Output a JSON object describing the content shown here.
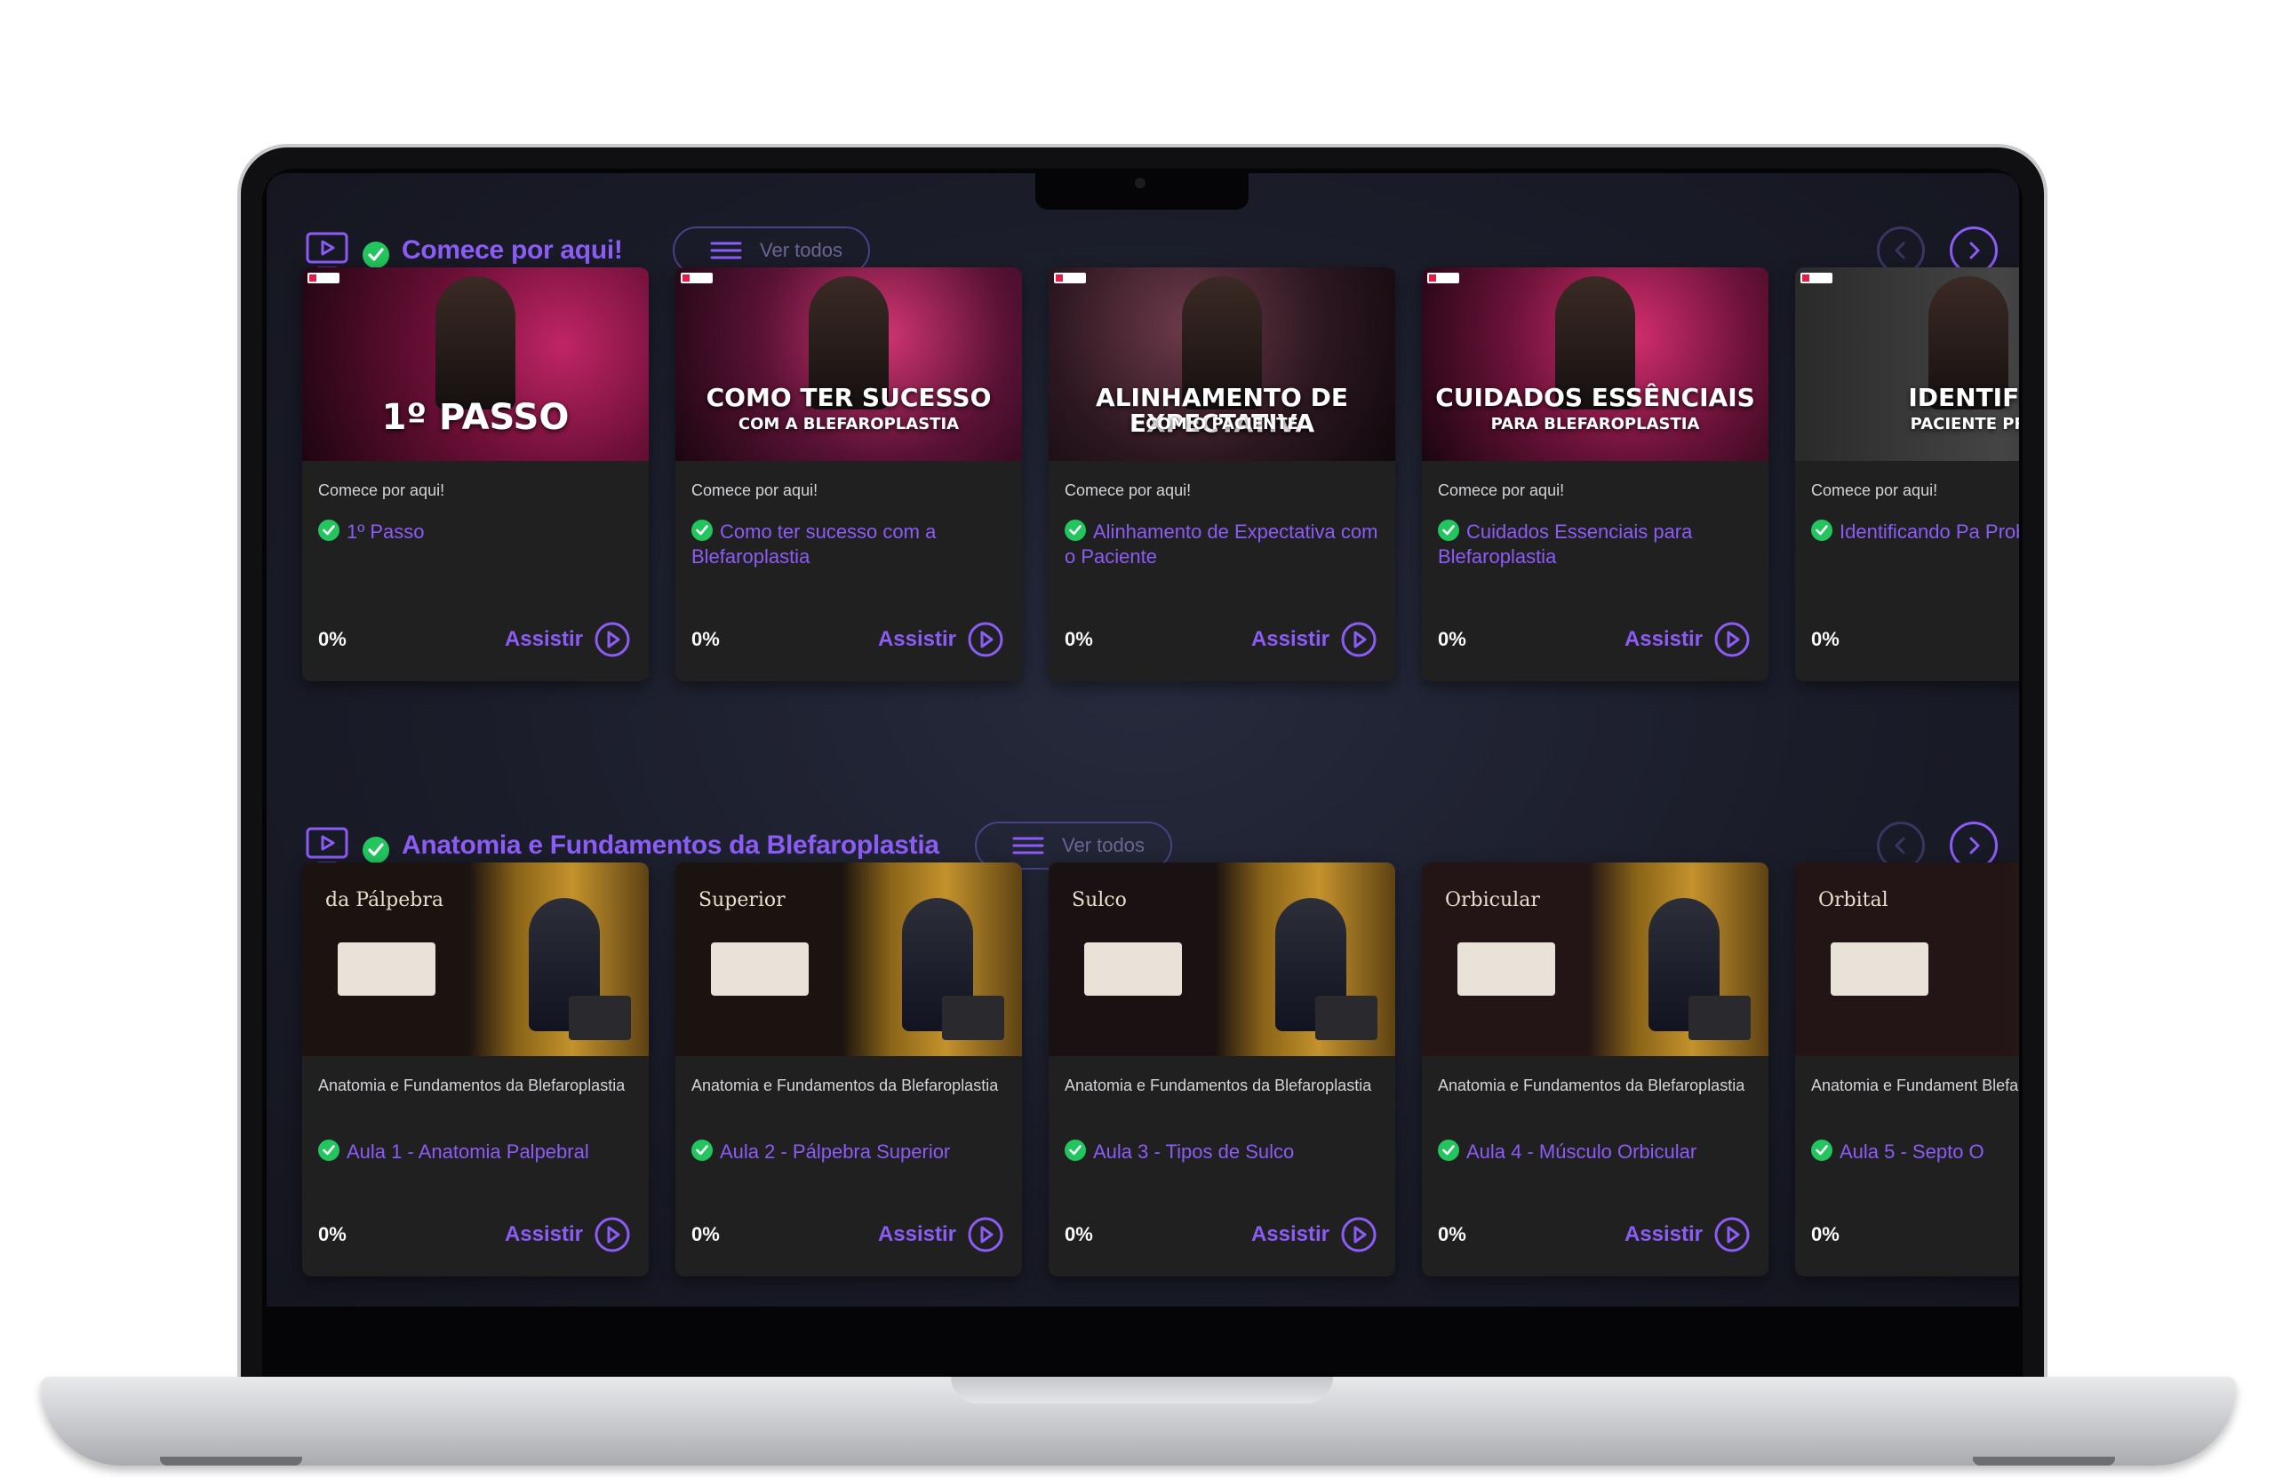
{
  "sections": [
    {
      "title": "Comece por aqui!",
      "ver_todos": "Ver todos",
      "cards": [
        {
          "thumb_line1": "1º PASSO",
          "thumb_line2": "",
          "module": "Comece por aqui!",
          "title": "1º Passo",
          "progress": "0%",
          "action": "Assistir"
        },
        {
          "thumb_line1": "COMO TER SUCESSO",
          "thumb_line2": "COM A BLEFAROPLASTIA",
          "module": "Comece por aqui!",
          "title": "Como ter sucesso com a Blefaroplastia",
          "progress": "0%",
          "action": "Assistir"
        },
        {
          "thumb_line1": "ALINHAMENTO DE EXPECTATIVA",
          "thumb_line2": "COM O PACIENTE",
          "module": "Comece por aqui!",
          "title": "Alinhamento de Expectativa com o Paciente",
          "progress": "0%",
          "action": "Assistir"
        },
        {
          "thumb_line1": "CUIDADOS ESSÊNCIAIS",
          "thumb_line2": "PARA BLEFAROPLASTIA",
          "module": "Comece por aqui!",
          "title": "Cuidados Essenciais para Blefaroplastia",
          "progress": "0%",
          "action": "Assistir"
        },
        {
          "thumb_line1": "IDENTIFI",
          "thumb_line2": "PACIENTE PR",
          "module": "Comece por aqui!",
          "title": "Identificando Pa Problema",
          "progress": "0%",
          "action": ""
        }
      ]
    },
    {
      "title": "Anatomia e Fundamentos da Blefaroplastia",
      "ver_todos": "Ver todos",
      "cards": [
        {
          "thumb_line1": "da Pálpebra",
          "thumb_line2": "",
          "module": "Anatomia e Fundamentos da Blefaroplastia",
          "title": "Aula 1 - Anatomia Palpebral",
          "progress": "0%",
          "action": "Assistir"
        },
        {
          "thumb_line1": "Superior",
          "thumb_line2": "",
          "module": "Anatomia e Fundamentos da Blefaroplastia",
          "title": "Aula 2 - Pálpebra Superior",
          "progress": "0%",
          "action": "Assistir"
        },
        {
          "thumb_line1": "Sulco",
          "thumb_line2": "",
          "module": "Anatomia e Fundamentos da Blefaroplastia",
          "title": "Aula 3 - Tipos de Sulco",
          "progress": "0%",
          "action": "Assistir"
        },
        {
          "thumb_line1": "Orbicular",
          "thumb_line2": "",
          "module": "Anatomia e Fundamentos da Blefaroplastia",
          "title": "Aula 4 - Músculo Orbicular",
          "progress": "0%",
          "action": "Assistir"
        },
        {
          "thumb_line1": "Orbital",
          "thumb_line2": "",
          "module": "Anatomia e Fundament Blefaroplastia",
          "title": "Aula 5 - Septo O",
          "progress": "0%",
          "action": ""
        }
      ]
    }
  ],
  "colors": {
    "accent": "#8b5cf6",
    "check": "#22c55e",
    "card_bg": "#202020",
    "screen_bg": "#1a1c29"
  },
  "icons": {
    "section": "tv-play-icon",
    "complete": "check-circle-icon",
    "list": "menu-icon",
    "prev": "chevron-left-icon",
    "next": "chevron-right-icon",
    "play": "play-circle-icon"
  }
}
